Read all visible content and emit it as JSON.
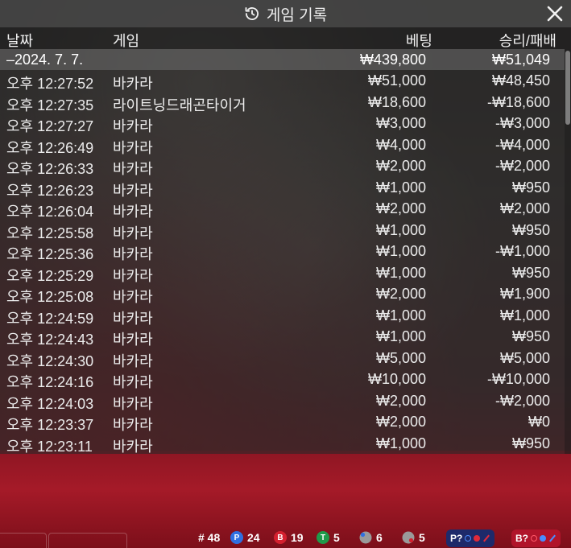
{
  "dialog": {
    "title": "게임 기록"
  },
  "columns": {
    "date": "날짜",
    "game": "게임",
    "bet": "베팅",
    "result": "승리/패배"
  },
  "group": {
    "date": "–2024. 7. 7.",
    "bet_total": "₩439,800",
    "result_total": "₩51,049"
  },
  "rows": [
    {
      "time": "오후 12:27:52",
      "game": "바카라",
      "bet": "₩51,000",
      "result": "₩48,450"
    },
    {
      "time": "오후 12:27:35",
      "game": "라이트닝드래곤타이거",
      "bet": "₩18,600",
      "result": "-₩18,600"
    },
    {
      "time": "오후 12:27:27",
      "game": "바카라",
      "bet": "₩3,000",
      "result": "-₩3,000"
    },
    {
      "time": "오후 12:26:49",
      "game": "바카라",
      "bet": "₩4,000",
      "result": "-₩4,000"
    },
    {
      "time": "오후 12:26:33",
      "game": "바카라",
      "bet": "₩2,000",
      "result": "-₩2,000"
    },
    {
      "time": "오후 12:26:23",
      "game": "바카라",
      "bet": "₩1,000",
      "result": "₩950"
    },
    {
      "time": "오후 12:26:04",
      "game": "바카라",
      "bet": "₩2,000",
      "result": "₩2,000"
    },
    {
      "time": "오후 12:25:58",
      "game": "바카라",
      "bet": "₩1,000",
      "result": "₩950"
    },
    {
      "time": "오후 12:25:36",
      "game": "바카라",
      "bet": "₩1,000",
      "result": "-₩1,000"
    },
    {
      "time": "오후 12:25:29",
      "game": "바카라",
      "bet": "₩1,000",
      "result": "₩950"
    },
    {
      "time": "오후 12:25:08",
      "game": "바카라",
      "bet": "₩2,000",
      "result": "₩1,900"
    },
    {
      "time": "오후 12:24:59",
      "game": "바카라",
      "bet": "₩1,000",
      "result": "₩1,000"
    },
    {
      "time": "오후 12:24:43",
      "game": "바카라",
      "bet": "₩1,000",
      "result": "₩950"
    },
    {
      "time": "오후 12:24:30",
      "game": "바카라",
      "bet": "₩5,000",
      "result": "₩5,000"
    },
    {
      "time": "오후 12:24:16",
      "game": "바카라",
      "bet": "₩10,000",
      "result": "-₩10,000"
    },
    {
      "time": "오후 12:24:03",
      "game": "바카라",
      "bet": "₩2,000",
      "result": "-₩2,000"
    },
    {
      "time": "오후 12:23:37",
      "game": "바카라",
      "bet": "₩2,000",
      "result": "₩0"
    },
    {
      "time": "오후 12:23:11",
      "game": "바카라",
      "bet": "₩1,000",
      "result": "₩950"
    }
  ],
  "stats": {
    "rounds_label": "# 48",
    "player_letter": "P",
    "player_count": "24",
    "banker_letter": "B",
    "banker_count": "19",
    "tie_letter": "T",
    "tie_count": "5",
    "player_pair_count": "6",
    "banker_pair_count": "5",
    "player_ask_label": "P?",
    "banker_ask_label": "B?"
  },
  "colors": {
    "player": "#2f6fe0",
    "banker": "#d4202f",
    "tie": "#1f9a4a"
  },
  "icons": {
    "title_icon": "history-icon",
    "close": "close-icon"
  }
}
